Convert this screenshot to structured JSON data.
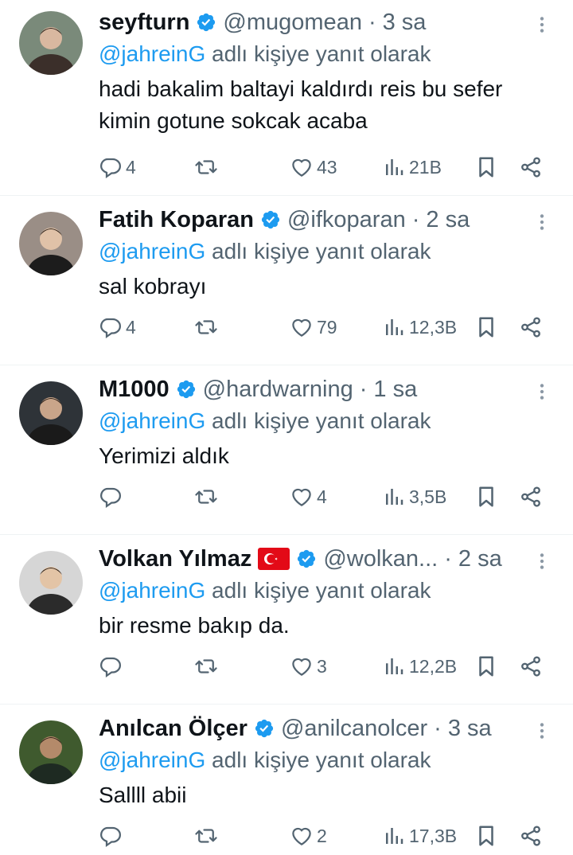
{
  "reply_prefix": "adlı kişiye yanıt olarak",
  "accent": "#1d9bf0",
  "muted": "#536471",
  "tweets": [
    {
      "name": "seyfturn",
      "verified": true,
      "flag": null,
      "handle": "@mugomean",
      "time": "3 sa",
      "reply_to": "@jahreinG",
      "text_lines": [
        "hadi bakalim baltayi kaldırdı reis bu sefer",
        "kimin gotune sokcak acaba"
      ],
      "replies": "4",
      "retweets": "",
      "likes": "43",
      "views": "21B",
      "avatar_icon": "person-avatar"
    },
    {
      "name": "Fatih Koparan",
      "verified": true,
      "flag": null,
      "handle": "@ifkoparan",
      "time": "2 sa",
      "reply_to": "@jahreinG",
      "text_lines": [
        "sal kobrayı"
      ],
      "replies": "4",
      "retweets": "",
      "likes": "79",
      "views": "12,3B",
      "avatar_icon": "person-avatar"
    },
    {
      "name": "M1000",
      "verified": true,
      "flag": null,
      "handle": "@hardwarning",
      "time": "1 sa",
      "reply_to": "@jahreinG",
      "text_lines": [
        "Yerimizi aldık"
      ],
      "replies": "",
      "retweets": "",
      "likes": "4",
      "views": "3,5B",
      "avatar_icon": "person-avatar"
    },
    {
      "name": "Volkan Yılmaz",
      "verified": true,
      "flag": "turkey-flag-icon",
      "handle": "@wolkan...",
      "time": "2 sa",
      "reply_to": "@jahreinG",
      "text_lines": [
        "bir resme bakıp da."
      ],
      "replies": "",
      "retweets": "",
      "likes": "3",
      "views": "12,2B",
      "avatar_icon": "person-avatar"
    },
    {
      "name": "Anılcan Ölçer",
      "verified": true,
      "flag": null,
      "handle": "@anilcanolcer",
      "time": "3 sa",
      "reply_to": "@jahreinG",
      "text_lines": [
        "Sallll abii"
      ],
      "replies": "",
      "retweets": "",
      "likes": "2",
      "views": "17,3B",
      "avatar_icon": "person-avatar"
    }
  ]
}
